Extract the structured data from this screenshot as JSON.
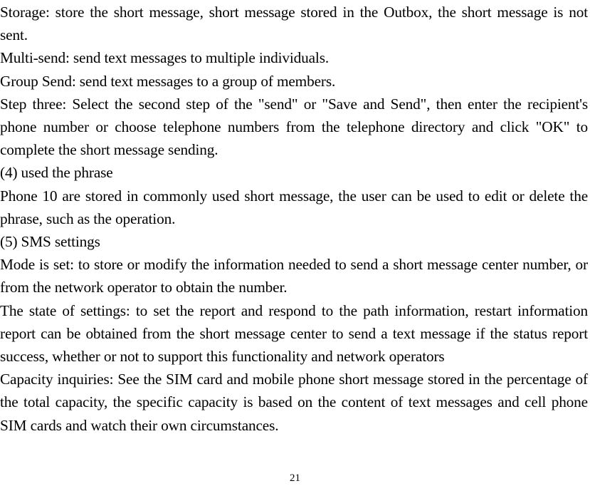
{
  "document": {
    "paragraphs": [
      "Storage: store the short message, short message stored in the Outbox, the short message is not sent.",
      "Multi-send: send text messages to multiple individuals.",
      "Group Send: send text messages to a group of members.",
      "Step three: Select the second step of the \"send\" or \"Save and Send\", then enter the recipient's phone number or choose telephone numbers from the telephone directory and click \"OK\" to complete the short message sending.",
      "(4) used the phrase",
      "Phone 10 are stored in commonly used short message, the user can be used to edit or delete the phrase, such as the operation.",
      "(5) SMS settings",
      "Mode is set: to store or modify the information needed to send a short message center number, or from the network operator to obtain the number.",
      "The state of settings: to set the report and respond to the path information, restart information report can be obtained from the short message center to send a text message if the status report success, whether or not to support this functionality and network operators",
      "Capacity inquiries: See the SIM card and mobile phone short message stored in the percentage of the total capacity, the specific capacity is based on the content of text messages and cell phone SIM cards and watch their own circumstances."
    ],
    "page_number": "21"
  }
}
